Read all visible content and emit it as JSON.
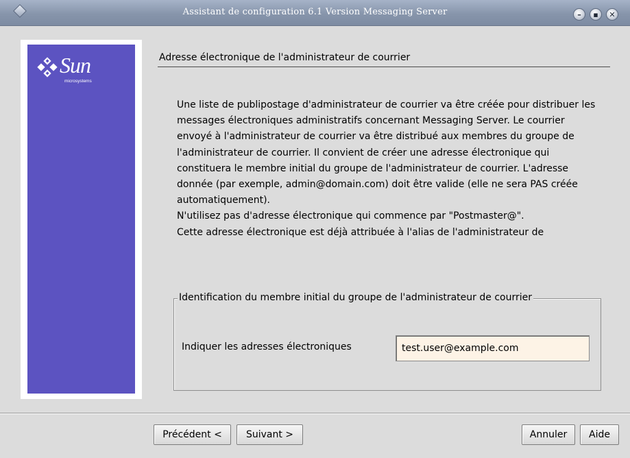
{
  "window": {
    "title": "Assistant de configuration 6.1 Version Messaging Server"
  },
  "branding": {
    "logo_text": "Sun",
    "logo_sub": "microsystems",
    "panel_color": "#5c53c1"
  },
  "section": {
    "title": "Adresse électronique de l'administrateur de courrier"
  },
  "description": {
    "paragraphs": [
      "Une liste de publipostage d'administrateur de courrier va être créée pour distribuer les messages électroniques administratifs concernant Messaging Server. Le courrier envoyé à l'administrateur de courrier va être distribué aux membres du groupe de l'administrateur de courrier.  Il convient de créer une adresse électronique qui constituera le membre initial du groupe de l'administrateur de courrier.  L'adresse donnée (par exemple, admin@domain.com) doit être valide (elle ne sera PAS créée automatiquement).",
      "N'utilisez pas d'adresse électronique qui commence par \"Postmaster@\".",
      "Cette adresse électronique est déjà attribuée à l'alias de l'administrateur de"
    ]
  },
  "group": {
    "legend": "Identification du membre initial du groupe de l'administrateur de courrier",
    "field_label": "Indiquer les adresses électroniques",
    "field_value": "test.user@example.com"
  },
  "buttons": {
    "previous": "Précédent <",
    "next": "Suivant >",
    "cancel": "Annuler",
    "help": "Aide"
  }
}
